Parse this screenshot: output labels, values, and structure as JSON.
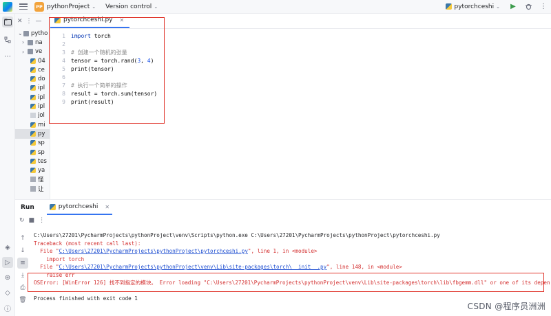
{
  "titlebar": {
    "project_badge": "PP",
    "project_name": "pythonProject",
    "version_control": "Version control",
    "run_config": "pytorchceshi"
  },
  "project_panel": {
    "items": [
      {
        "label": "pytho",
        "type": "root"
      },
      {
        "label": "na",
        "type": "folder"
      },
      {
        "label": "ve",
        "type": "folder"
      },
      {
        "label": "04",
        "type": "py"
      },
      {
        "label": "ce",
        "type": "py"
      },
      {
        "label": "do",
        "type": "py"
      },
      {
        "label": "ipl",
        "type": "py"
      },
      {
        "label": "ipl",
        "type": "py"
      },
      {
        "label": "ipl",
        "type": "py"
      },
      {
        "label": "jol",
        "type": "file"
      },
      {
        "label": "mi",
        "type": "py"
      },
      {
        "label": "py",
        "type": "py",
        "selected": true
      },
      {
        "label": "sp",
        "type": "py"
      },
      {
        "label": "sp",
        "type": "py"
      },
      {
        "label": "tes",
        "type": "py"
      },
      {
        "label": "ya",
        "type": "py"
      },
      {
        "label": "怪",
        "type": "txt"
      },
      {
        "label": "让",
        "type": "txt"
      }
    ]
  },
  "editor": {
    "tab_label": "pytorchceshi.py",
    "lines": [
      {
        "n": "1",
        "kind": "import",
        "kw": "import",
        "rest": " torch"
      },
      {
        "n": "2",
        "kind": "blank",
        "text": ""
      },
      {
        "n": "3",
        "kind": "comment",
        "text": "# 创建一个随机的张量"
      },
      {
        "n": "4",
        "kind": "code",
        "pre": "tensor = torch.rand(",
        "a": "3",
        "mid": ", ",
        "b": "4",
        "post": ")"
      },
      {
        "n": "5",
        "kind": "plain",
        "text": "print(tensor)"
      },
      {
        "n": "6",
        "kind": "blank",
        "text": ""
      },
      {
        "n": "7",
        "kind": "comment",
        "text": "# 执行一个简单的操作"
      },
      {
        "n": "8",
        "kind": "plain",
        "text": "result = torch.sum(tensor)"
      },
      {
        "n": "9",
        "kind": "plain",
        "text": "print(result)"
      }
    ]
  },
  "run": {
    "title": "Run",
    "tab_label": "pytorchceshi",
    "console": {
      "cmd": "C:\\Users\\27201\\PycharmProjects\\pythonProject\\venv\\Scripts\\python.exe C:\\Users\\27201\\PycharmProjects\\pythonProject\\pytorchceshi.py",
      "traceback": "Traceback (most recent call last):",
      "file1_pre": "  File \"",
      "file1_link": "C:\\Users\\27201\\PycharmProjects\\pythonProject\\pytorchceshi.py",
      "file1_post": "\", line 1, in <module>",
      "import_line": "    import torch",
      "file2_pre": "  File \"",
      "file2_link": "C:\\Users\\27201\\PycharmProjects\\pythonProject\\venv\\Lib\\site-packages\\torch\\__init__.py",
      "file2_post": "\", line 148, in <module>",
      "raise_line": "    raise err",
      "oserror": "OSError: [WinError 126] 找不到指定的模块。 Error loading \"C:\\Users\\27201\\PycharmProjects\\pythonProject\\venv\\Lib\\site-packages\\torch\\lib\\fbgemm.dll\" or one of its dependencies.",
      "finished": "Process finished with exit code 1"
    }
  },
  "watermark": "CSDN @程序员洲洲",
  "colors": {
    "accent": "#3574f0",
    "error_red": "#d32f2f",
    "highlight_box": "#e0352b",
    "link": "#1f4fd1"
  }
}
